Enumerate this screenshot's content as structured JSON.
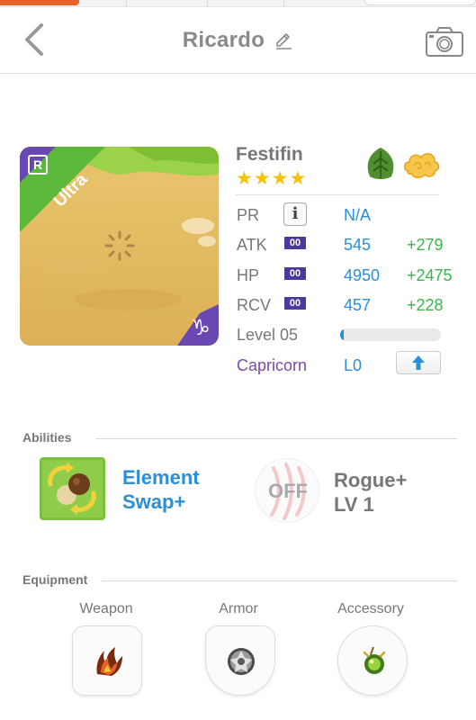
{
  "header": {
    "title": "Ricardo",
    "icons": [
      "back-chevron-icon",
      "edit-pencil-icon",
      "camera-icon"
    ]
  },
  "monster": {
    "name": "Festifin",
    "stars": "★★★★",
    "rarity_badge": "R",
    "ribbon": "Ultra",
    "zodiac_glyph": "♑",
    "attributes": [
      "leaf-icon",
      "cloud-icon"
    ]
  },
  "stats": {
    "pr": {
      "label": "PR",
      "value": "N/A",
      "info_glyph": "i"
    },
    "atk": {
      "label": "ATK",
      "plus": "00",
      "value": "545",
      "bonus": "+279"
    },
    "hp": {
      "label": "HP",
      "plus": "00",
      "value": "4950",
      "bonus": "+2475"
    },
    "rcv": {
      "label": "RCV",
      "plus": "00",
      "value": "457",
      "bonus": "+228"
    },
    "level": {
      "label": "Level 05",
      "progress": 0.02
    },
    "sign": {
      "label": "Capricorn",
      "level": "L0",
      "upgrade_icon": "arrow-up-icon"
    }
  },
  "abilities": {
    "label": "Abilities",
    "active": {
      "name_line1": "Element",
      "name_line2": "Swap+"
    },
    "passive": {
      "status": "OFF",
      "name_line1": "Rogue+",
      "name_line2": "LV 1"
    }
  },
  "equipment": {
    "label": "Equipment",
    "slots": [
      {
        "label": "Weapon",
        "icon": "claw-weapon-icon"
      },
      {
        "label": "Armor",
        "icon": "shield-orb-icon"
      },
      {
        "label": "Accessory",
        "icon": "green-charm-icon"
      }
    ]
  },
  "colors": {
    "accent_blue": "#2a8fd6",
    "bonus_green": "#3cb44b",
    "capricorn_purple": "#7a4aa8",
    "ultra_green": "#5cb83a",
    "header_orange": "#e8622a"
  }
}
